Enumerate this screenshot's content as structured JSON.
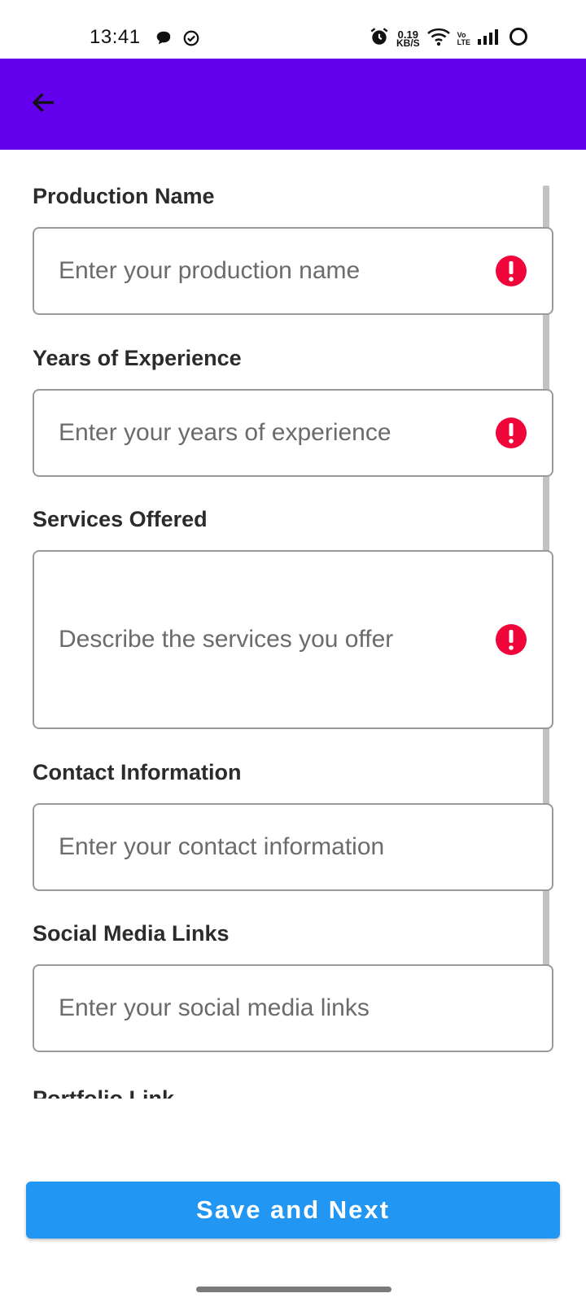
{
  "status_bar": {
    "time": "13:41",
    "left_icons": [
      "chat-bubble-icon",
      "check-circle-icon"
    ],
    "net_speed_value": "0.19",
    "net_speed_unit": "KB/S",
    "volte_top": "Vo",
    "volte_bottom": "LTE",
    "right_icons": [
      "alarm-icon",
      "wifi-icon",
      "signal-icon",
      "battery-icon"
    ]
  },
  "app_bar": {
    "color": "#6200ee",
    "back_icon": "arrow-left-icon"
  },
  "form": {
    "fields": [
      {
        "label": "Production Name",
        "placeholder": "Enter your production name",
        "value": "",
        "error": true
      },
      {
        "label": "Years of Experience",
        "placeholder": "Enter your years of experience",
        "value": "",
        "error": true
      },
      {
        "label": "Services Offered",
        "placeholder": "Describe the services you offer",
        "value": "",
        "error": true
      },
      {
        "label": "Contact Information",
        "placeholder": "Enter your contact information",
        "value": "",
        "error": false
      },
      {
        "label": "Social Media Links",
        "placeholder": "Enter your social media links",
        "value": "",
        "error": false
      }
    ],
    "partial_label": "Portfolio Link",
    "error_color": "#f0053a"
  },
  "footer": {
    "save_label": "Save and Next",
    "button_color": "#2196f3"
  }
}
